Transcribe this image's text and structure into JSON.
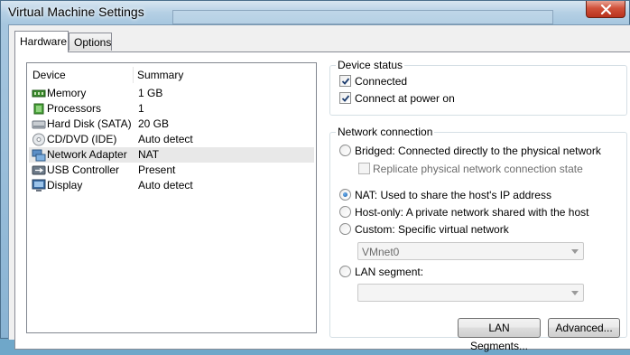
{
  "window": {
    "title": "Virtual Machine Settings"
  },
  "tabs": [
    {
      "label": "Hardware",
      "active": true
    },
    {
      "label": "Options",
      "active": false
    }
  ],
  "device_list": {
    "headers": {
      "device": "Device",
      "summary": "Summary"
    },
    "rows": [
      {
        "icon": "memory-icon",
        "device": "Memory",
        "summary": "1 GB"
      },
      {
        "icon": "processor-icon",
        "device": "Processors",
        "summary": "1"
      },
      {
        "icon": "hard-disk-icon",
        "device": "Hard Disk (SATA)",
        "summary": "20 GB"
      },
      {
        "icon": "cd-dvd-icon",
        "device": "CD/DVD (IDE)",
        "summary": "Auto detect"
      },
      {
        "icon": "network-adapter-icon",
        "device": "Network Adapter",
        "summary": "NAT",
        "selected": true
      },
      {
        "icon": "usb-icon",
        "device": "USB Controller",
        "summary": "Present"
      },
      {
        "icon": "display-icon",
        "device": "Display",
        "summary": "Auto detect"
      }
    ]
  },
  "device_status": {
    "title": "Device status",
    "connected": {
      "label": "Connected",
      "checked": true
    },
    "connect_at_power_on": {
      "label": "Connect at power on",
      "checked": true
    }
  },
  "network_connection": {
    "title": "Network connection",
    "bridged": {
      "label": "Bridged: Connected directly to the physical network",
      "selected": false
    },
    "replicate": {
      "label": "Replicate physical network connection state",
      "checked": false,
      "enabled": false
    },
    "nat": {
      "label": "NAT: Used to share the host's IP address",
      "selected": true
    },
    "host_only": {
      "label": "Host-only: A private network shared with the host",
      "selected": false
    },
    "custom": {
      "label": "Custom: Specific virtual network",
      "selected": false
    },
    "custom_select_value": "VMnet0",
    "lan_segment": {
      "label": "LAN segment:",
      "selected": false
    },
    "lan_segment_select_value": ""
  },
  "buttons": {
    "lan_segments": "LAN Segments...",
    "advanced": "Advanced..."
  },
  "colors": {
    "accent": "#1b5ea8",
    "close": "#c7422b",
    "titlebar": "#89b3d3"
  }
}
